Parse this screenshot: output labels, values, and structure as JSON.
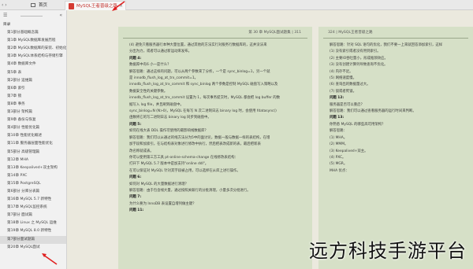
{
  "tabs": {
    "home_label": "首页",
    "doc_label": "MySQL王者晋级之路",
    "doc_close": "×"
  },
  "sidebar": {
    "root_label": "目录",
    "items": [
      "第1部分基础概念篇",
      "第1章 MySQL数据库发展历程",
      "第2章 MySQL数据库的安装、初始化",
      "第3章 MySQL体系结构与存储引擎",
      "第4章 数据库文件",
      "第5章 表",
      "第2部分 运维篇",
      "第6章 索引",
      "第7章 锁",
      "第8章 事务",
      "第3部分 架构篇",
      "第9章 备份与恢复",
      "第4部分 性能优化篇",
      "第10章 性能优化概述",
      "第11章 服务器层面性能优化",
      "第5部分 高级管理篇",
      "第12章 MHA",
      "第13章 Keepalived+双主架构",
      "第14章 PXC",
      "第15章 PostgreSQL",
      "第6部分 分库分表篇",
      "第16章 MySQL 5.7 新特性",
      "第17章 MySQL监控系统",
      "第7部分 面试篇",
      "第18章 Linux 之 MySQL 运维",
      "第19章 MySQL 8.0 新特性",
      "第7部分面试题篇",
      "第20章 MySQL面试"
    ],
    "active_index": 26
  },
  "pages": {
    "left": {
      "header": "第 30 章 MySQL面试题集 | 311",
      "lines": [
        {
          "t": "(4) 避免只看服务器行本种大量位置，通过其他的方法实行对服务行数据库的，这并没法来",
          "q": false
        },
        {
          "t": "分出为力，或者可以通过新运动来发布。",
          "q": false
        },
        {
          "t": "问题 4:",
          "q": true
        },
        {
          "t": "数据库中有6 小一是什么？",
          "q": false
        },
        {
          "t": "解答思路：通过这样的问题，可以从两个参数来了分析，一个是 sync_binlog=1，另一个就",
          "q": false
        },
        {
          "t": "是 innodb_flush_log_at_trx_commit=1。",
          "q": false
        },
        {
          "t": "innodb_flush_log_at_trx_commit 和 sync_binlog 两个参数是控制 MySQL 磁盘写入策略以及",
          "q": false
        },
        {
          "t": "数据安全性的关键参数。",
          "q": false
        },
        {
          "t": "innodb_flush_log_at_trx_commit 设置为 1，每次事务提交时，MySQL 都会把 log buffer 的数",
          "q": false
        },
        {
          "t": "据写入 log file，并且刷到磁盘中。",
          "q": false
        },
        {
          "t": "sync_binlog=N (N>0)，MySQL 在每写 N 次二进制日志 binary log 时，会使用 fdatasync()",
          "q": false
        },
        {
          "t": "函数将它的写二进制日志 binary log 同步到磁盘中。",
          "q": false
        },
        {
          "t": "问题 5:",
          "q": true
        },
        {
          "t": "如何在线大表 DDL 操作可使用的最影响线数据库？",
          "q": false
        },
        {
          "t": "解答思路：我们可以从通过的线方法分为5中的面讨论，数据一般与数据一样的表结构，在增",
          "q": false
        },
        {
          "t": "加字段和加索引，在与结构表对象进行修改中执行，然后把表改成新的表，最后把新表",
          "q": false
        },
        {
          "t": "改名称就成表。",
          "q": false
        },
        {
          "t": "你可以使用第三方工具 pt-online-schema-change 在线修改表结构：",
          "q": false
        },
        {
          "t": "打开下 MySQL 5.7 版本中是加支持\"online ddl\"。",
          "q": false
        },
        {
          "t": "在可以保证对 MySQL 针对其字段被占用，可以选择在从库上进行操作。",
          "q": false
        },
        {
          "t": "问题 6:",
          "q": true
        },
        {
          "t": "如何对 MySQL 的大量数据进行清理？",
          "q": false
        },
        {
          "t": "解答思路：由于包含线大量，通过按照关联行的分批清理，小量多次分批进行。",
          "q": false
        },
        {
          "t": "问题 7:",
          "q": true
        },
        {
          "t": "为什么要为 InnoDB 表设置自增列做主键？",
          "q": false
        },
        {
          "t": "问题 11:",
          "q": true
        }
      ]
    },
    "right": {
      "header": "324 | MySQL王者晋级之路",
      "lines": [
        {
          "t": "解答思路：针对 SQL 语句的优化，我们不要一上来就回答添加索引，这样",
          "q": false
        },
        {
          "t": "(1) 没有索引或者没有用到索引。",
          "q": false
        },
        {
          "t": "(2) 主要IO吞吐量小，形成瓶颈效应。",
          "q": false
        },
        {
          "t": "(3) 没有创建计算列导致查询不优化。",
          "q": false
        },
        {
          "t": "(4) 内存不足。",
          "q": false
        },
        {
          "t": "(5) 网络速度慢。",
          "q": false
        },
        {
          "t": "(6) 查询出的数据量过大。",
          "q": false
        },
        {
          "t": "(7) 锁或者死锁。",
          "q": false
        },
        {
          "t": "问题 12:",
          "q": true
        },
        {
          "t": "服务器是否可以重启？",
          "q": false
        },
        {
          "t": "解答思路：我们可以通过查看服务器的运行时间来判断。",
          "q": false
        },
        {
          "t": "问题 13:",
          "q": true
        },
        {
          "t": "你熟悉 MySQL 的哪些高可用架构？",
          "q": false
        },
        {
          "t": "解答思路：",
          "q": false
        },
        {
          "t": "(1) MHA。",
          "q": false
        },
        {
          "t": "(2) MMM。",
          "q": false
        },
        {
          "t": "(3) Keepalived+双主。",
          "q": false
        },
        {
          "t": "(4) PXC。",
          "q": false
        },
        {
          "t": "(5) MGR。",
          "q": false
        },
        {
          "t": "MHA 优点：",
          "q": false
        }
      ]
    }
  },
  "watermark": "远方科技手游平台"
}
